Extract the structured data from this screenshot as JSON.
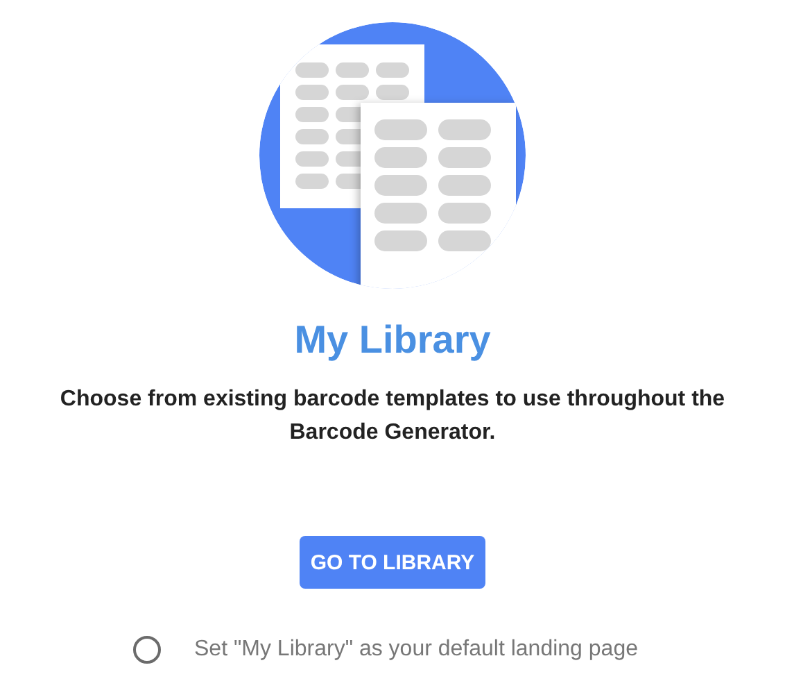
{
  "title": "My Library",
  "description": "Choose from existing barcode templates to use throughout the Barcode Generator.",
  "button": {
    "label": "GO TO LIBRARY"
  },
  "default_option": {
    "label": "Set \"My Library\" as your default landing page",
    "checked": false
  }
}
